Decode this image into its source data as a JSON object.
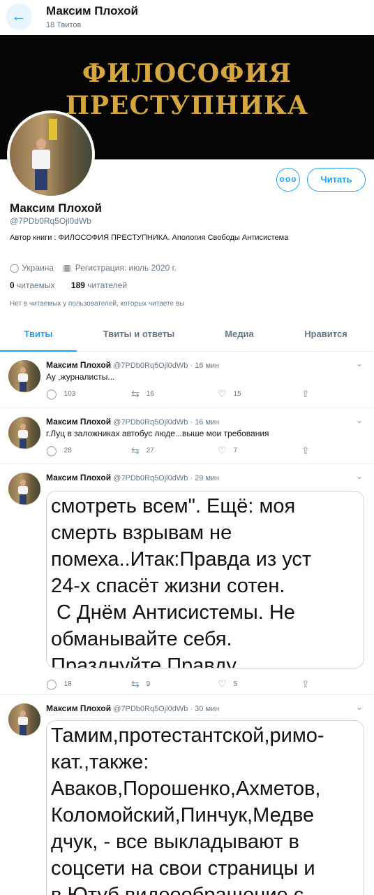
{
  "header": {
    "title": "Максим Плохой",
    "tweet_count": "18 Твитов",
    "back_icon": "arrow-left-icon"
  },
  "banner": {
    "line1": "ФИЛОСОФИЯ",
    "line2": "ПРЕСТУПНИКА"
  },
  "profile": {
    "name": "Максим Плохой",
    "handle": "@7PDb0Rq5Ojl0dWb",
    "bio": "Автор книги : ФИЛОСОФИЯ ПРЕСТУПНИКА. Апология Свободы Антисистема",
    "location": "Украина",
    "joined": "Регистрация: июль 2020 г.",
    "following_count": "0",
    "following_label": "читаемых",
    "followers_count": "189",
    "followers_label": "читателей",
    "followed_by_note": "Нет в читаемых у пользователей, которых читаете вы",
    "more_label": "ооо",
    "follow_label": "Читать"
  },
  "tabs": [
    {
      "label": "Твиты",
      "active": true
    },
    {
      "label": "Твиты и ответы",
      "active": false
    },
    {
      "label": "Медиа",
      "active": false
    },
    {
      "label": "Нравится",
      "active": false
    }
  ],
  "tweets": [
    {
      "author": "Максим Плохой",
      "handle": "@7PDb0Rq5Ojl0dWb",
      "time": "· 16 мин",
      "text": "Ау ,журналисты...",
      "replies": "103",
      "retweets": "16",
      "likes": "15"
    },
    {
      "author": "Максим Плохой",
      "handle": "@7PDb0Rq5Ojl0dWb",
      "time": "· 16 мин",
      "text": "г.Луц в заложниках автобус люде...выше мои требования",
      "replies": "28",
      "retweets": "27",
      "likes": "7"
    },
    {
      "author": "Максим Плохой",
      "handle": "@7PDb0Rq5Ojl0dWb",
      "time": "· 29 мин",
      "image_text": "смотреть всем\". Ещё: моя\nсмерть взрывам не\nпомеха..Итак:Правда из уст\n24-х спасёт жизни сотен.\n С Днём Антисистемы. Не\nобманывайте себя.\nПразднуйте Правду",
      "replies": "18",
      "retweets": "9",
      "likes": "5"
    },
    {
      "author": "Максим Плохой",
      "handle": "@7PDb0Rq5Ojl0dWb",
      "time": "· 30 мин",
      "image_text": "Тамим,протестантской,римо-\nкат.,также:\nАваков,Порошенко,Ахметов,\nКоломойский,Пинчук,Медве\nдчук, - все выкладывают в\nсоцсети на свои страницы и\nв Ютуб видеообращение с"
    }
  ],
  "icons": {
    "reply": "reply-icon",
    "retweet": "retweet-icon",
    "like": "heart-icon",
    "share": "share-icon",
    "caret": "chevron-down-icon",
    "location": "location-pin-icon",
    "calendar": "calendar-icon"
  },
  "colors": {
    "accent": "#1da1f2",
    "muted": "#657786",
    "banner_text": "#d6a640",
    "banner_bg": "#050505"
  }
}
